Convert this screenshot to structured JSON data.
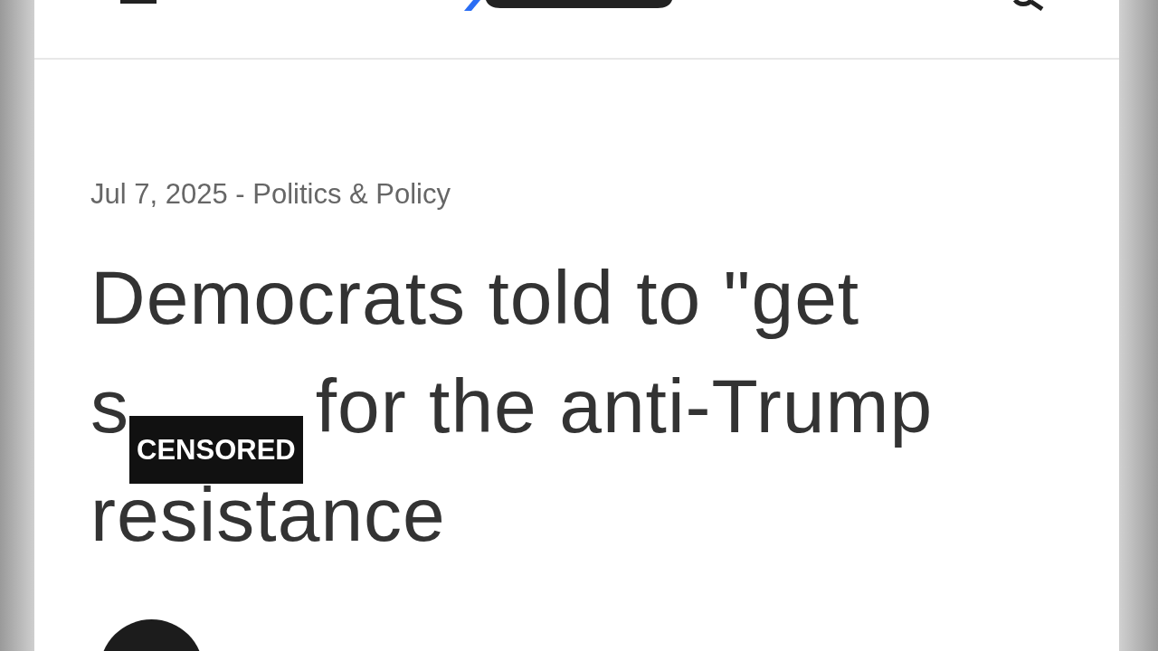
{
  "header": {
    "kind": "news"
  },
  "article": {
    "meta": "Jul 7, 2025 - Politics & Policy",
    "headline_lines": [
      [
        {
          "kind": "text",
          "text": "Democrats told to \"get"
        }
      ],
      [
        {
          "kind": "text",
          "text": "s"
        },
        {
          "kind": "overlay",
          "text": "CENSORED"
        },
        {
          "kind": "text",
          "text": "for the anti-Trump"
        }
      ],
      [
        {
          "kind": "text",
          "text": "resistance"
        }
      ]
    ]
  }
}
